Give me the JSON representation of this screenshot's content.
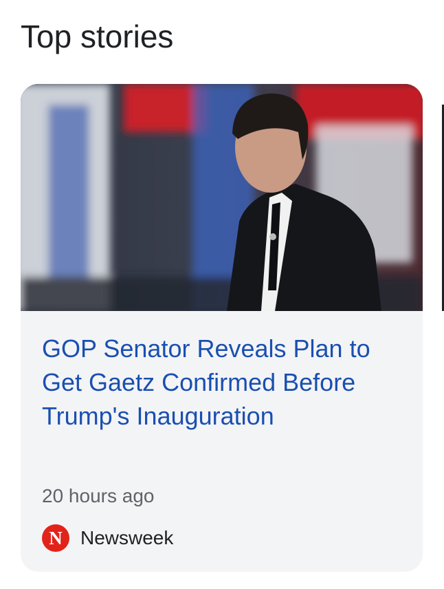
{
  "section": {
    "title": "Top stories"
  },
  "story": {
    "headline": "GOP Senator Reveals Plan to Get Gaetz Confirmed Before Trump's Inauguration",
    "time": "20 hours ago",
    "source": {
      "name": "Newsweek",
      "logo_letter": "N",
      "logo_color": "#e2231a"
    },
    "thumbnail_icon": "news-photo"
  },
  "colors": {
    "headline": "#1a4fb0",
    "card_bg": "#f3f4f6",
    "muted_text": "#5f6368"
  }
}
